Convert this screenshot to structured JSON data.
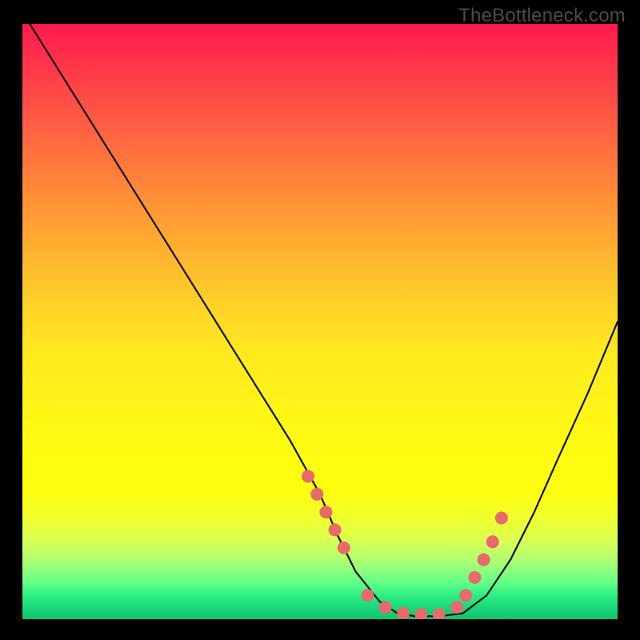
{
  "watermark": "TheBottleneck.com",
  "colors": {
    "marker": "#e86a6a",
    "curve": "#111111",
    "bg_frame": "#000000"
  },
  "chart_data": {
    "type": "line",
    "title": "",
    "xlabel": "",
    "ylabel": "",
    "xlim": [
      0,
      100
    ],
    "ylim": [
      0,
      100
    ],
    "grid": false,
    "series": [
      {
        "name": "bottleneck-curve",
        "x": [
          0,
          5,
          10,
          15,
          20,
          25,
          30,
          35,
          40,
          45,
          50,
          53,
          56,
          60,
          63,
          66,
          70,
          74,
          78,
          82,
          86,
          90,
          95,
          100
        ],
        "y": [
          102,
          94,
          86,
          78,
          70,
          62,
          54,
          46,
          38,
          30,
          21,
          14,
          8,
          3,
          1,
          0.5,
          0.5,
          1,
          4,
          10,
          18,
          27,
          38,
          50
        ]
      }
    ],
    "markers": {
      "name": "highlight-points",
      "x": [
        48,
        49.5,
        51,
        52.5,
        54,
        58,
        61,
        64,
        67,
        70,
        73,
        74.5,
        76,
        77.5,
        79,
        80.5
      ],
      "y": [
        24,
        21,
        18,
        15,
        12,
        4,
        2,
        1,
        0.8,
        0.8,
        2,
        4,
        7,
        10,
        13,
        17
      ]
    }
  }
}
